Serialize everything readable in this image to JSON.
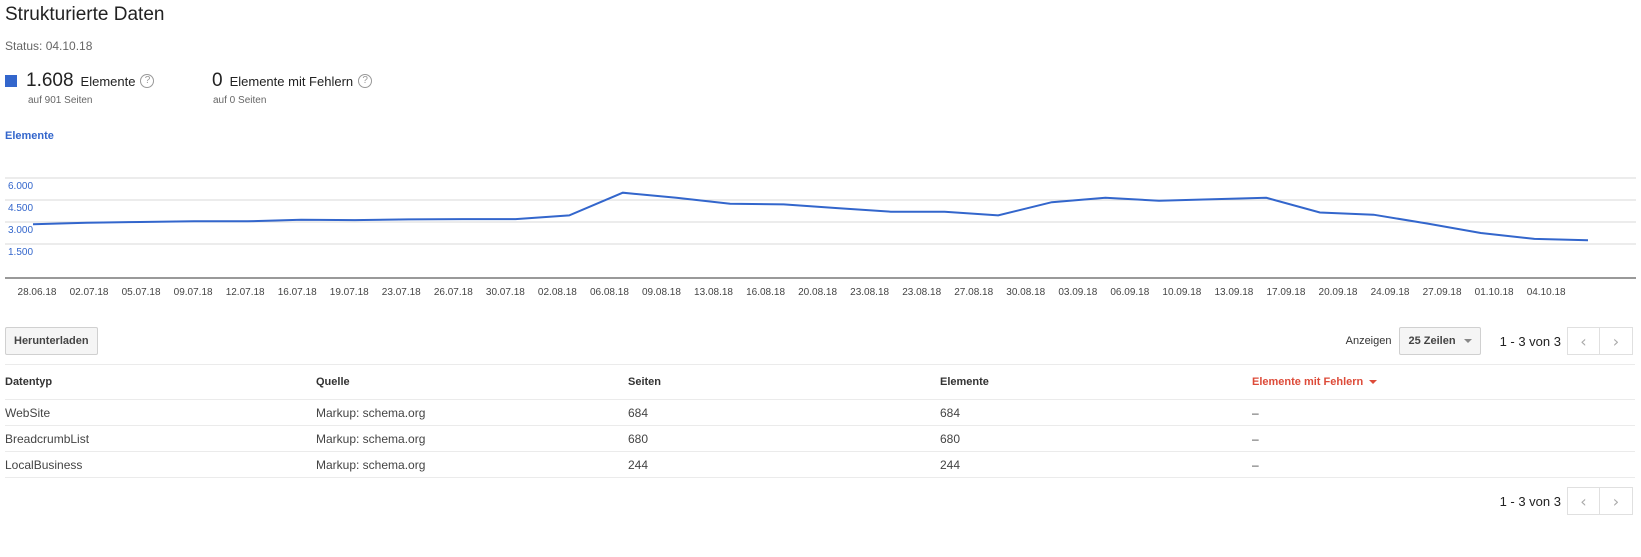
{
  "header": {
    "title": "Strukturierte Daten",
    "status": "Status: 04.10.18"
  },
  "summary": {
    "items": {
      "value": "1.608",
      "label": "Elemente",
      "sub": "auf 901 Seiten",
      "color": "#3366cc"
    },
    "errors": {
      "value": "0",
      "label": "Elemente mit Fehlern",
      "sub": "auf 0 Seiten"
    }
  },
  "chart_data": {
    "type": "line",
    "title": "Elemente",
    "x": [
      "28.06.18",
      "02.07.18",
      "05.07.18",
      "09.07.18",
      "12.07.18",
      "16.07.18",
      "19.07.18",
      "23.07.18",
      "26.07.18",
      "30.07.18",
      "02.08.18",
      "06.08.18",
      "09.08.18",
      "13.08.18",
      "16.08.18",
      "20.08.18",
      "23.08.18",
      "23.08.18",
      "27.08.18",
      "30.08.18",
      "03.09.18",
      "06.09.18",
      "10.09.18",
      "13.09.18",
      "17.09.18",
      "20.09.18",
      "24.09.18",
      "27.09.18",
      "01.10.18",
      "04.10.18"
    ],
    "series": [
      {
        "values": [
          2850,
          2950,
          3000,
          3050,
          3050,
          3150,
          3130,
          3180,
          3200,
          3200,
          3450,
          5000,
          4650,
          4250,
          4200,
          3950,
          3700,
          3700,
          3450,
          4350,
          4650,
          4450,
          4550,
          4650,
          3650,
          3500,
          2900,
          2250,
          1850,
          1750
        ],
        "color": "#3366cc"
      }
    ],
    "yticks": [
      "6.000",
      "4.500",
      "3.000",
      "1.500"
    ],
    "ytick_values": [
      6000,
      4500,
      3000,
      1500
    ],
    "ylim": [
      0,
      6000
    ],
    "grid": true,
    "legend": "none"
  },
  "toolbar": {
    "download_label": "Herunterladen",
    "show_label": "Anzeigen",
    "rows_option": "25 Zeilen",
    "range": "1 - 3 von 3"
  },
  "table": {
    "headers": [
      "Datentyp",
      "Quelle",
      "Seiten",
      "Elemente",
      "Elemente mit Fehlern"
    ],
    "rows": [
      [
        "WebSite",
        "Markup: schema.org",
        "684",
        "684",
        "–"
      ],
      [
        "BreadcrumbList",
        "Markup: schema.org",
        "680",
        "680",
        "–"
      ],
      [
        "LocalBusiness",
        "Markup: schema.org",
        "244",
        "244",
        "–"
      ]
    ]
  },
  "icons": {
    "help": "help-circle-icon",
    "prev": "chevron-left-icon",
    "next": "chevron-right-icon",
    "dropdown": "caret-down-icon"
  }
}
